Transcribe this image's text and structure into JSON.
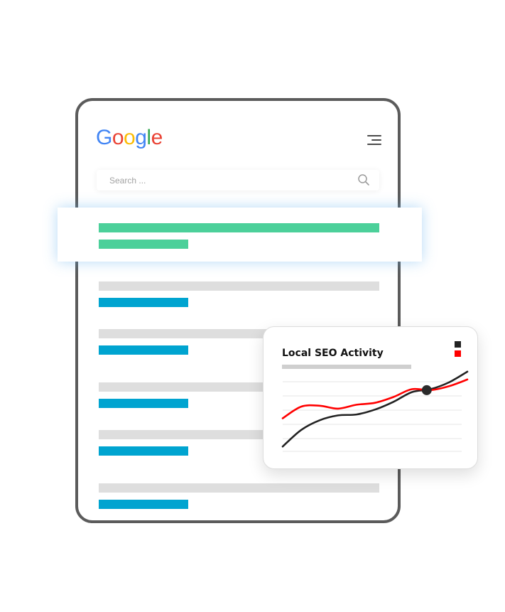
{
  "logo": {
    "letters": [
      {
        "char": "G",
        "color": "#4285F4"
      },
      {
        "char": "o",
        "color": "#EA4335"
      },
      {
        "char": "o",
        "color": "#FBBC05"
      },
      {
        "char": "g",
        "color": "#4285F4"
      },
      {
        "char": "l",
        "color": "#34A853"
      },
      {
        "char": "e",
        "color": "#EA4335"
      }
    ]
  },
  "header": {
    "menu_icon": "hamburger-menu-icon"
  },
  "search": {
    "placeholder": "Search ...",
    "icon": "magnifier-icon"
  },
  "results": {
    "highlighted": {
      "color": "#4cd09a"
    },
    "items": [
      {
        "title_color": "#dedede",
        "link_color": "#00a4d0"
      },
      {
        "title_color": "#dedede",
        "link_color": "#00a4d0"
      },
      {
        "title_color": "#dedede",
        "link_color": "#00a4d0"
      },
      {
        "title_color": "#dedede",
        "link_color": "#00a4d0"
      },
      {
        "title_color": "#dedede",
        "link_color": "#00a4d0"
      }
    ]
  },
  "chart_card": {
    "title": "Local SEO Activity",
    "legend": [
      {
        "color": "#222222"
      },
      {
        "color": "#ff0000"
      }
    ]
  },
  "chart_data": {
    "type": "line",
    "title": "Local SEO Activity",
    "xlabel": "",
    "ylabel": "",
    "grid": true,
    "series": [
      {
        "color": "#222222",
        "x": [
          0,
          1,
          2,
          3,
          4,
          5,
          6,
          7,
          8,
          9,
          10
        ],
        "values": [
          0.5,
          2.2,
          3.2,
          3.7,
          3.8,
          4.3,
          5.1,
          6.1,
          6.4,
          7.1,
          8.2
        ]
      },
      {
        "color": "#ff0000",
        "x": [
          0,
          1,
          2,
          3,
          4,
          5,
          6,
          7,
          8,
          9,
          10
        ],
        "values": [
          3.4,
          4.6,
          4.7,
          4.4,
          4.8,
          5.0,
          5.6,
          6.4,
          6.3,
          6.7,
          7.4
        ]
      }
    ],
    "highlight_point": {
      "x": 7.8,
      "y": 6.3
    },
    "ylim": [
      0,
      9
    ]
  }
}
